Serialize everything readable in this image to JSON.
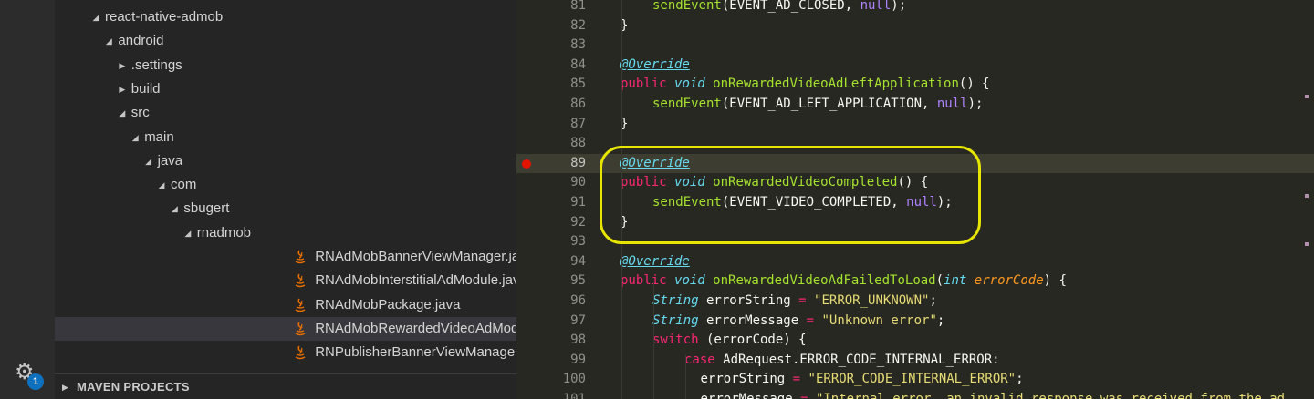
{
  "activity_bar": {
    "badge_count": "1",
    "gear_icon": "gear-icon"
  },
  "explorer": {
    "items": [
      {
        "label": "react-native-admob",
        "depth": 0,
        "kind": "folder-open"
      },
      {
        "label": "android",
        "depth": 1,
        "kind": "folder-open"
      },
      {
        "label": ".settings",
        "depth": 2,
        "kind": "folder-closed"
      },
      {
        "label": "build",
        "depth": 2,
        "kind": "folder-closed"
      },
      {
        "label": "src",
        "depth": 2,
        "kind": "folder-open"
      },
      {
        "label": "main",
        "depth": 3,
        "kind": "folder-open"
      },
      {
        "label": "java",
        "depth": 4,
        "kind": "folder-open"
      },
      {
        "label": "com",
        "depth": 5,
        "kind": "folder-open"
      },
      {
        "label": "sbugert",
        "depth": 6,
        "kind": "folder-open"
      },
      {
        "label": "rnadmob",
        "depth": 7,
        "kind": "folder-open"
      },
      {
        "label": "RNAdMobBannerViewManager.java",
        "depth": 8,
        "kind": "java-file"
      },
      {
        "label": "RNAdMobInterstitialAdModule.java",
        "depth": 8,
        "kind": "java-file"
      },
      {
        "label": "RNAdMobPackage.java",
        "depth": 8,
        "kind": "java-file"
      },
      {
        "label": "RNAdMobRewardedVideoAdModule.java",
        "depth": 8,
        "kind": "java-file",
        "selected": true
      },
      {
        "label": "RNPublisherBannerViewManager.java",
        "depth": 8,
        "kind": "java-file"
      }
    ],
    "maven_panel_title": "MAVEN PROJECTS"
  },
  "editor": {
    "breakpoint_line": "89",
    "current_line": "89",
    "lines": [
      {
        "n": "81",
        "indent": 2,
        "tokens": [
          [
            "fn",
            "sendEvent"
          ],
          [
            "plain",
            "(EVENT_AD_CLOSED, "
          ],
          [
            "const",
            "null"
          ],
          [
            "plain",
            ");"
          ]
        ]
      },
      {
        "n": "82",
        "indent": 1,
        "tokens": [
          [
            "plain",
            "}"
          ]
        ]
      },
      {
        "n": "83",
        "indent": 0,
        "tokens": []
      },
      {
        "n": "84",
        "indent": 1,
        "tokens": [
          [
            "anno",
            "@Override"
          ]
        ]
      },
      {
        "n": "85",
        "indent": 1,
        "tokens": [
          [
            "kw",
            "public"
          ],
          [
            "plain",
            " "
          ],
          [
            "type",
            "void"
          ],
          [
            "plain",
            " "
          ],
          [
            "fn",
            "onRewardedVideoAdLeftApplication"
          ],
          [
            "plain",
            "() {"
          ]
        ]
      },
      {
        "n": "86",
        "indent": 2,
        "tokens": [
          [
            "fn",
            "sendEvent"
          ],
          [
            "plain",
            "(EVENT_AD_LEFT_APPLICATION, "
          ],
          [
            "const",
            "null"
          ],
          [
            "plain",
            ");"
          ]
        ]
      },
      {
        "n": "87",
        "indent": 1,
        "tokens": [
          [
            "plain",
            "}"
          ]
        ]
      },
      {
        "n": "88",
        "indent": 0,
        "tokens": []
      },
      {
        "n": "89",
        "indent": 1,
        "tokens": [
          [
            "anno",
            "@Override"
          ]
        ]
      },
      {
        "n": "90",
        "indent": 1,
        "tokens": [
          [
            "kw",
            "public"
          ],
          [
            "plain",
            " "
          ],
          [
            "type",
            "void"
          ],
          [
            "plain",
            " "
          ],
          [
            "fn",
            "onRewardedVideoCompleted"
          ],
          [
            "plain",
            "() {"
          ]
        ]
      },
      {
        "n": "91",
        "indent": 2,
        "tokens": [
          [
            "fn",
            "sendEvent"
          ],
          [
            "plain",
            "(EVENT_VIDEO_COMPLETED, "
          ],
          [
            "const",
            "null"
          ],
          [
            "plain",
            ");"
          ]
        ]
      },
      {
        "n": "92",
        "indent": 1,
        "tokens": [
          [
            "plain",
            "}"
          ]
        ]
      },
      {
        "n": "93",
        "indent": 0,
        "tokens": []
      },
      {
        "n": "94",
        "indent": 1,
        "tokens": [
          [
            "anno",
            "@Override"
          ]
        ]
      },
      {
        "n": "95",
        "indent": 1,
        "tokens": [
          [
            "kw",
            "public"
          ],
          [
            "plain",
            " "
          ],
          [
            "type",
            "void"
          ],
          [
            "plain",
            " "
          ],
          [
            "fn",
            "onRewardedVideoAdFailedToLoad"
          ],
          [
            "plain",
            "("
          ],
          [
            "type",
            "int"
          ],
          [
            "plain",
            " "
          ],
          [
            "param",
            "errorCode"
          ],
          [
            "plain",
            ") {"
          ]
        ]
      },
      {
        "n": "96",
        "indent": 2,
        "tokens": [
          [
            "type",
            "String"
          ],
          [
            "plain",
            " errorString "
          ],
          [
            "kw",
            "="
          ],
          [
            "plain",
            " "
          ],
          [
            "str",
            "\"ERROR_UNKNOWN\""
          ],
          [
            "plain",
            ";"
          ]
        ]
      },
      {
        "n": "97",
        "indent": 2,
        "tokens": [
          [
            "type",
            "String"
          ],
          [
            "plain",
            " errorMessage "
          ],
          [
            "kw",
            "="
          ],
          [
            "plain",
            " "
          ],
          [
            "str",
            "\"Unknown error\""
          ],
          [
            "plain",
            ";"
          ]
        ]
      },
      {
        "n": "98",
        "indent": 2,
        "tokens": [
          [
            "kw",
            "switch"
          ],
          [
            "plain",
            " (errorCode) {"
          ]
        ]
      },
      {
        "n": "99",
        "indent": 3,
        "tokens": [
          [
            "kw",
            "case"
          ],
          [
            "plain",
            " AdRequest.ERROR_CODE_INTERNAL_ERROR:"
          ]
        ]
      },
      {
        "n": "100",
        "indent": 3.5,
        "tokens": [
          [
            "plain",
            "errorString "
          ],
          [
            "kw",
            "="
          ],
          [
            "plain",
            " "
          ],
          [
            "str",
            "\"ERROR_CODE_INTERNAL_ERROR\""
          ],
          [
            "plain",
            ";"
          ]
        ]
      },
      {
        "n": "101",
        "indent": 3.5,
        "tokens": [
          [
            "plain",
            "errorMessage "
          ],
          [
            "kw",
            "="
          ],
          [
            "plain",
            " "
          ],
          [
            "str",
            "\"Internal error, an invalid response was received from the ad"
          ]
        ]
      }
    ]
  }
}
